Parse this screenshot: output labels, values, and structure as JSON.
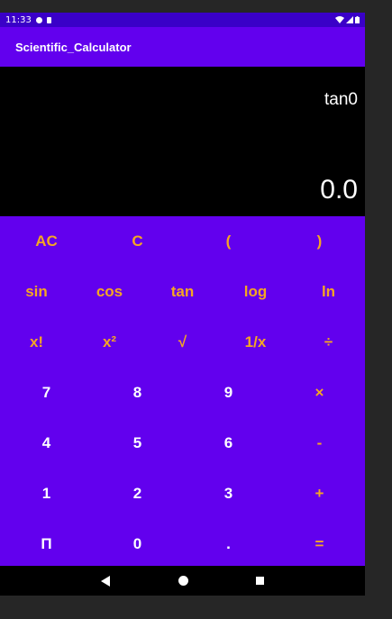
{
  "status": {
    "time": "11:33"
  },
  "app": {
    "title": "Scientific_Calculator"
  },
  "display": {
    "expression": "tan0",
    "result": "0.0"
  },
  "colors": {
    "primary": "#6200ee",
    "status_bar": "#3a00c8",
    "accent": "#f5a623"
  },
  "keys": {
    "row1": [
      "AC",
      "C",
      "(",
      ")"
    ],
    "row2": [
      "sin",
      "cos",
      "tan",
      "log",
      "ln"
    ],
    "row3": [
      "x!",
      "x²",
      "√",
      "1/x",
      "÷"
    ],
    "row4": [
      "7",
      "8",
      "9",
      "×"
    ],
    "row5": [
      "4",
      "5",
      "6",
      "-"
    ],
    "row6": [
      "1",
      "2",
      "3",
      "+"
    ],
    "row7": [
      "Π",
      "0",
      ".",
      "="
    ]
  },
  "nav": {
    "back_icon": "back-icon",
    "home_icon": "home-icon",
    "recents_icon": "recents-icon"
  }
}
